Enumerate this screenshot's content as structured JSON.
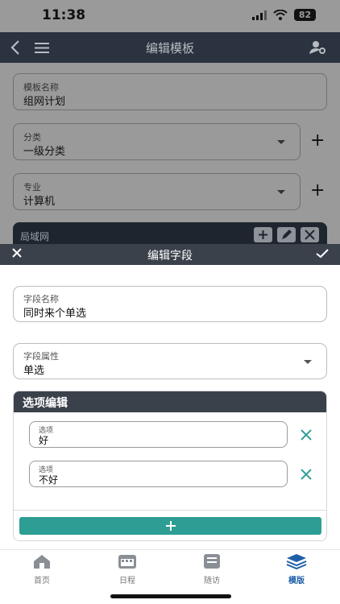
{
  "status": {
    "time": "11:38",
    "battery": "82"
  },
  "nav": {
    "title": "编辑模板"
  },
  "background": {
    "template_name": {
      "label": "模板名称",
      "value": "组网计划"
    },
    "category": {
      "label": "分类",
      "value": "一级分类"
    },
    "major": {
      "label": "专业",
      "value": "计算机"
    },
    "lan_item": "局域网"
  },
  "sheet": {
    "title": "编辑字段",
    "field_name": {
      "label": "字段名称",
      "value": "同时来个单选"
    },
    "field_attr": {
      "label": "字段属性",
      "value": "单选"
    },
    "options_header": "选项编辑",
    "options": [
      {
        "label": "选项",
        "value": "好"
      },
      {
        "label": "选项",
        "value": "不好"
      }
    ]
  },
  "tabs": [
    {
      "label": "首页",
      "icon": "home-icon"
    },
    {
      "label": "日程",
      "icon": "calendar-icon"
    },
    {
      "label": "随访",
      "icon": "followup-icon"
    },
    {
      "label": "模版",
      "icon": "layers-icon",
      "active": true
    }
  ],
  "colors": {
    "accent": "#2e9e94",
    "header": "#3a414b",
    "tab_active": "#1f5fa8"
  }
}
